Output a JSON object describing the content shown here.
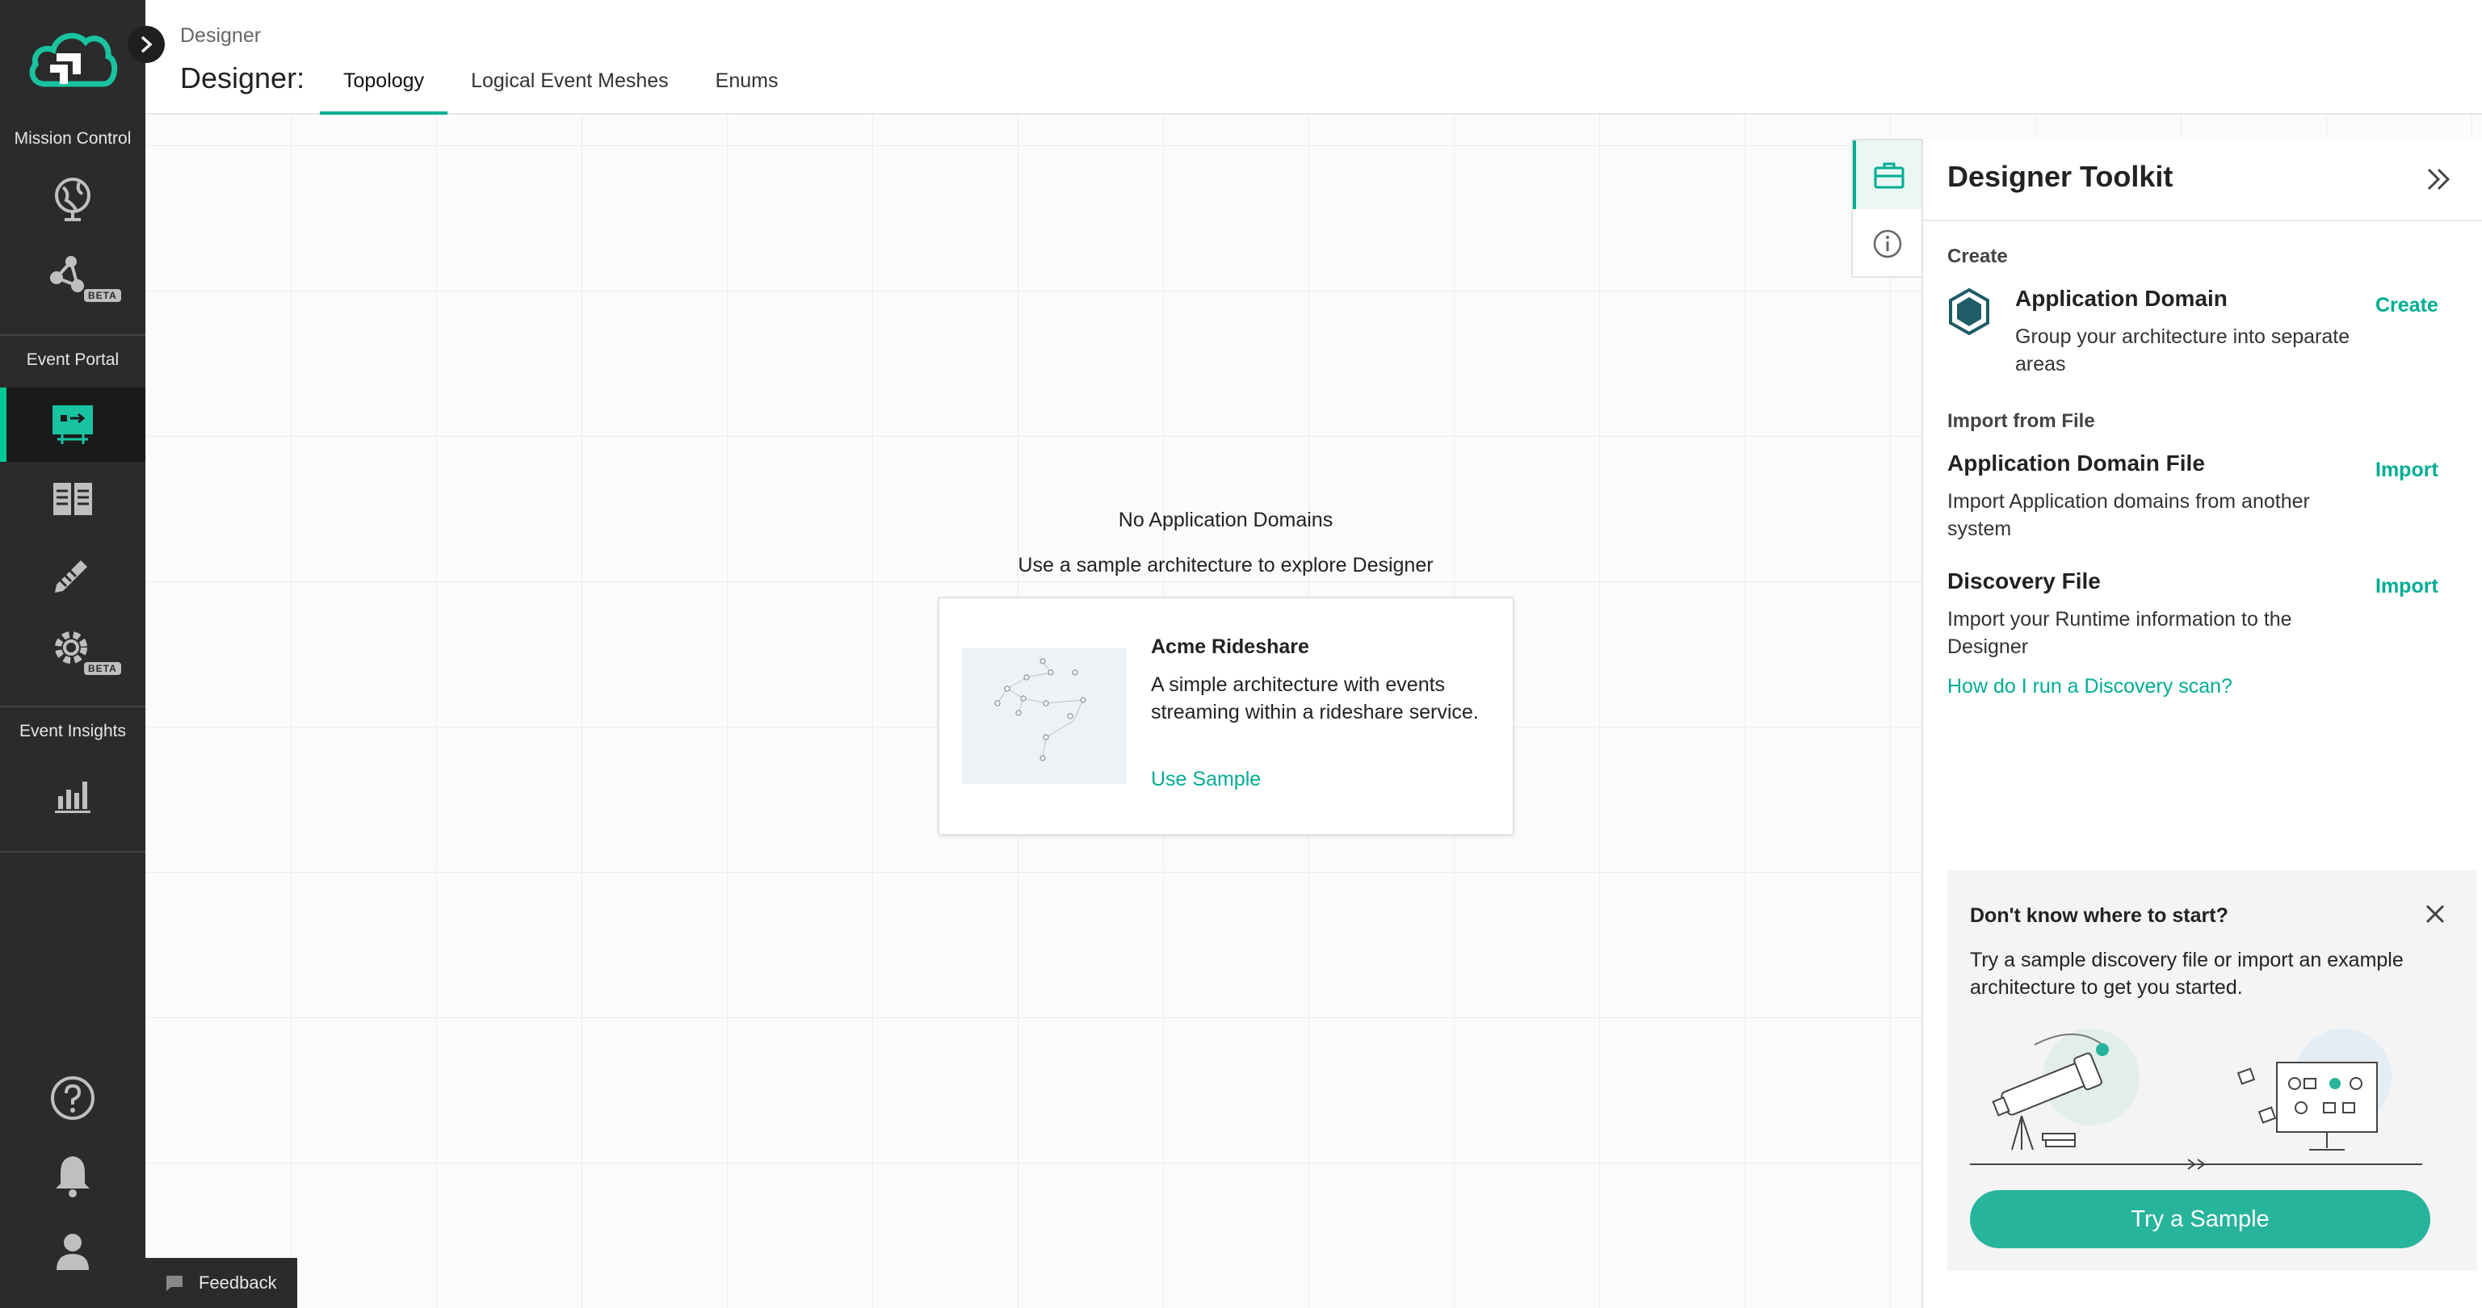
{
  "nav": {
    "sections": [
      {
        "title": "Mission Control"
      },
      {
        "title": "Event Portal"
      },
      {
        "title": "Event Insights"
      }
    ],
    "beta_label": "BETA"
  },
  "header": {
    "breadcrumb": "Designer",
    "title": "Designer:",
    "tabs": [
      {
        "label": "Topology",
        "active": true
      },
      {
        "label": "Logical Event Meshes",
        "active": false
      },
      {
        "label": "Enums",
        "active": false
      }
    ]
  },
  "canvas": {
    "empty_title": "No Application Domains",
    "empty_subtitle": "Use a sample architecture to explore Designer",
    "sample": {
      "name": "Acme Rideshare",
      "description": "A simple architecture with events streaming within a rideshare service.",
      "link": "Use Sample"
    }
  },
  "toolkit": {
    "title": "Designer Toolkit",
    "create_section": "Create",
    "create_items": [
      {
        "title": "Application Domain",
        "description": "Group your architecture into separate areas",
        "action": "Create"
      }
    ],
    "import_section": "Import from File",
    "import_items": [
      {
        "title": "Application Domain File",
        "description": "Import Application domains from another system",
        "action": "Import"
      },
      {
        "title": "Discovery File",
        "description": "Import your Runtime information to the Designer",
        "action": "Import"
      }
    ],
    "discovery_link": "How do I run a Discovery scan?",
    "start": {
      "title": "Don't know where to start?",
      "description": "Try a sample discovery file or import an example architecture to get you started.",
      "button": "Try a Sample"
    }
  },
  "feedback": "Feedback",
  "colors": {
    "accent": "#00ad93",
    "nav_bg": "#2b2b2b",
    "button": "#26b49a"
  }
}
